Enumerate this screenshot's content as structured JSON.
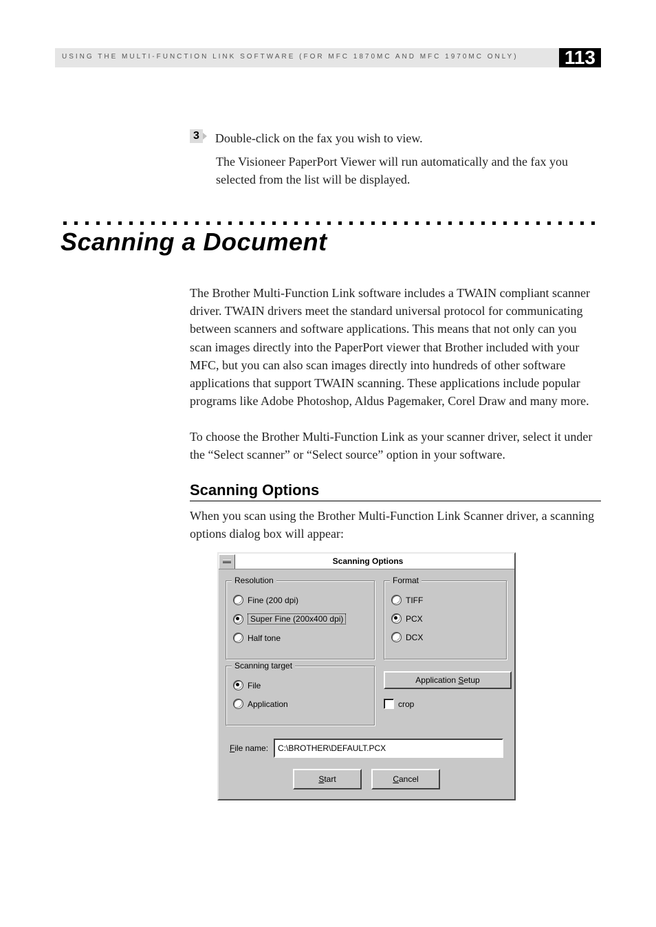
{
  "header": {
    "running_head": "USING THE MULTI-FUNCTION LINK SOFTWARE (FOR MFC 1870MC AND MFC 1970MC ONLY)",
    "page_number": "113"
  },
  "step3": {
    "number": "3",
    "line1": "Double-click on the fax you wish to view.",
    "line2": "The Visioneer PaperPort Viewer will run automatically and the fax you selected from the list will be displayed."
  },
  "section": {
    "title": "Scanning a Document",
    "para1": "The Brother Multi-Function Link software includes a TWAIN compliant scanner driver.  TWAIN drivers meet the standard universal protocol for communicating between scanners and software applications.  This means that not only can you scan images directly into the PaperPort viewer that Brother included with your MFC, but you can also scan images directly into hundreds of other software applications that support TWAIN scanning.  These applications include popular programs like Adobe Photoshop, Aldus Pagemaker, Corel Draw and many more.",
    "para2": "To choose the Brother Multi-Function Link as your scanner driver, select it under the “Select scanner” or “Select source” option in your software.",
    "h2": "Scanning Options",
    "para3": "When you scan using the Brother Multi-Function Link Scanner driver, a scanning options dialog box will appear:"
  },
  "dialog": {
    "title": "Scanning Options",
    "groups": {
      "resolution": {
        "legend": "Resolution",
        "opt_fine": "Fine (200 dpi)",
        "opt_super": "Super Fine (200x400 dpi)",
        "opt_half": "Half tone",
        "selected": "super"
      },
      "format": {
        "legend": "Format",
        "opt_tiff": "TIFF",
        "opt_pcx": "PCX",
        "opt_dcx": "DCX",
        "selected": "pcx"
      },
      "target": {
        "legend": "Scanning target",
        "opt_file": "File",
        "opt_app": "Application",
        "selected": "file"
      }
    },
    "setup_btn": "Application Setup",
    "crop_checkbox": "crop",
    "filename_label": "File name:",
    "filename_value": "C:\\BROTHER\\DEFAULT.PCX",
    "start_btn": "Start",
    "cancel_btn": "Cancel"
  }
}
